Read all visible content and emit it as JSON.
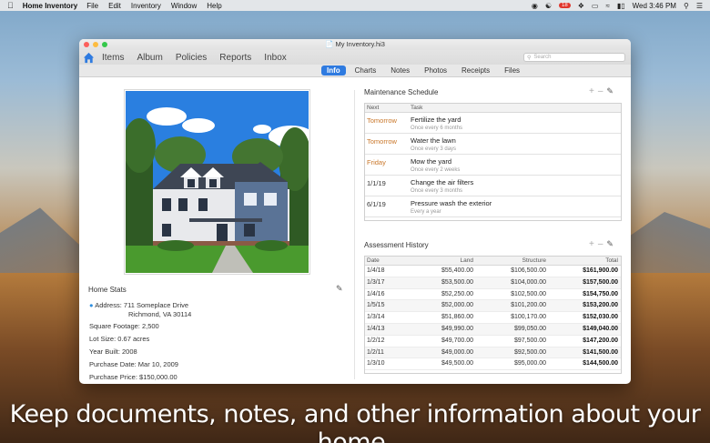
{
  "menubar": {
    "app_name": "Home Inventory",
    "menus": [
      "File",
      "Edit",
      "Inventory",
      "Window",
      "Help"
    ],
    "notification_count": "18",
    "clock": "Wed 3:46 PM"
  },
  "window": {
    "title": "My Inventory.hi3",
    "nav": [
      "Items",
      "Album",
      "Policies",
      "Reports",
      "Inbox"
    ],
    "search_placeholder": "Search",
    "subtabs": [
      "Info",
      "Charts",
      "Notes",
      "Photos",
      "Receipts",
      "Files"
    ],
    "active_subtab": "Info"
  },
  "home_stats": {
    "title": "Home Stats",
    "address_label": "Address:",
    "address_line1": "711 Someplace Drive",
    "address_line2": "Richmond, VA 30114",
    "square_footage": "Square Footage:  2,500",
    "lot_size": "Lot Size:  0.67 acres",
    "year_built": "Year Built:  2008",
    "purchase_date": "Purchase Date:  Mar 10, 2009",
    "purchase_price": "Purchase Price:  $150,000.00"
  },
  "maintenance": {
    "title": "Maintenance Schedule",
    "headers": {
      "next": "Next",
      "task": "Task"
    },
    "rows": [
      {
        "next": "Tomorrow",
        "task": "Fertilize the yard",
        "freq": "Once every 6 months",
        "highlight": true
      },
      {
        "next": "Tomorrow",
        "task": "Water the lawn",
        "freq": "Once every 3 days",
        "highlight": true
      },
      {
        "next": "Friday",
        "task": "Mow the yard",
        "freq": "Once every 2 weeks",
        "highlight": true
      },
      {
        "next": "1/1/19",
        "task": "Change the air filters",
        "freq": "Once every 3 months",
        "highlight": false
      },
      {
        "next": "6/1/19",
        "task": "Pressure wash the exterior",
        "freq": "Every a year",
        "highlight": false
      }
    ]
  },
  "assessment": {
    "title": "Assessment History",
    "headers": {
      "date": "Date",
      "land": "Land",
      "structure": "Structure",
      "total": "Total"
    },
    "rows": [
      {
        "date": "1/4/18",
        "land": "$55,400.00",
        "structure": "$106,500.00",
        "total": "$161,900.00"
      },
      {
        "date": "1/3/17",
        "land": "$53,500.00",
        "structure": "$104,000.00",
        "total": "$157,500.00"
      },
      {
        "date": "1/4/16",
        "land": "$52,250.00",
        "structure": "$102,500.00",
        "total": "$154,750.00"
      },
      {
        "date": "1/5/15",
        "land": "$52,000.00",
        "structure": "$101,200.00",
        "total": "$153,200.00"
      },
      {
        "date": "1/3/14",
        "land": "$51,860.00",
        "structure": "$100,170.00",
        "total": "$152,030.00"
      },
      {
        "date": "1/4/13",
        "land": "$49,990.00",
        "structure": "$99,050.00",
        "total": "$149,040.00"
      },
      {
        "date": "1/2/12",
        "land": "$49,700.00",
        "structure": "$97,500.00",
        "total": "$147,200.00"
      },
      {
        "date": "1/2/11",
        "land": "$49,000.00",
        "structure": "$92,500.00",
        "total": "$141,500.00"
      },
      {
        "date": "1/3/10",
        "land": "$49,500.00",
        "structure": "$95,000.00",
        "total": "$144,500.00"
      }
    ]
  },
  "caption": "Keep documents, notes, and other information about your home.",
  "colors": {
    "accent": "#2f7be0",
    "highlight_text": "#c9772a"
  }
}
